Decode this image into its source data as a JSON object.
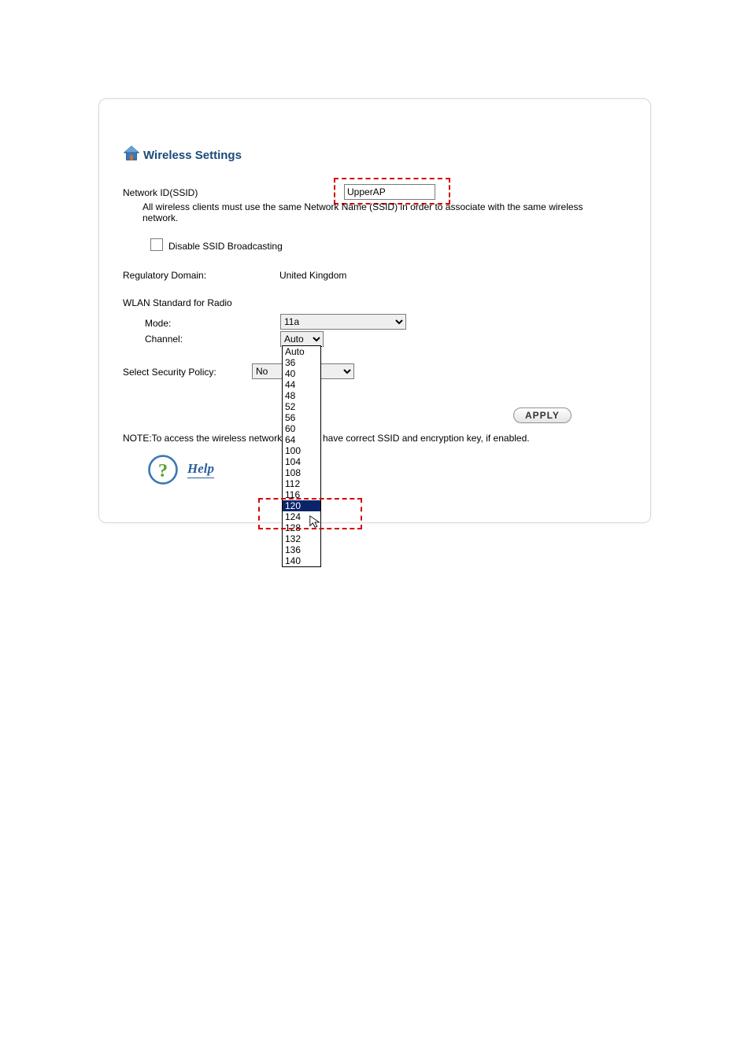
{
  "title": "Wireless Settings",
  "ssid": {
    "label": "Network ID(SSID)",
    "value": "UpperAP",
    "hint": "All wireless clients must use the same Network Name (SSID) in order to associate with the same wireless network."
  },
  "disable_ssid": {
    "label": "Disable SSID Broadcasting",
    "checked": false
  },
  "regulatory": {
    "label": "Regulatory Domain:",
    "value": "United Kingdom"
  },
  "wlan_std_label": "WLAN Standard for Radio",
  "mode": {
    "label": "Mode:",
    "value": "11a"
  },
  "channel": {
    "label": "Channel:",
    "value": "Auto",
    "options": [
      "Auto",
      "36",
      "40",
      "44",
      "48",
      "52",
      "56",
      "60",
      "64",
      "100",
      "104",
      "108",
      "112",
      "116",
      "120",
      "124",
      "128",
      "132",
      "136",
      "140"
    ],
    "highlighted": "120"
  },
  "security": {
    "label": "Select Security Policy:",
    "value": "No"
  },
  "apply_label": "APPLY",
  "note": {
    "prefix": "NOTE:To access the wireless network,",
    "suffix": "have correct SSID and encryption key, if enabled."
  },
  "help_label": "Help"
}
